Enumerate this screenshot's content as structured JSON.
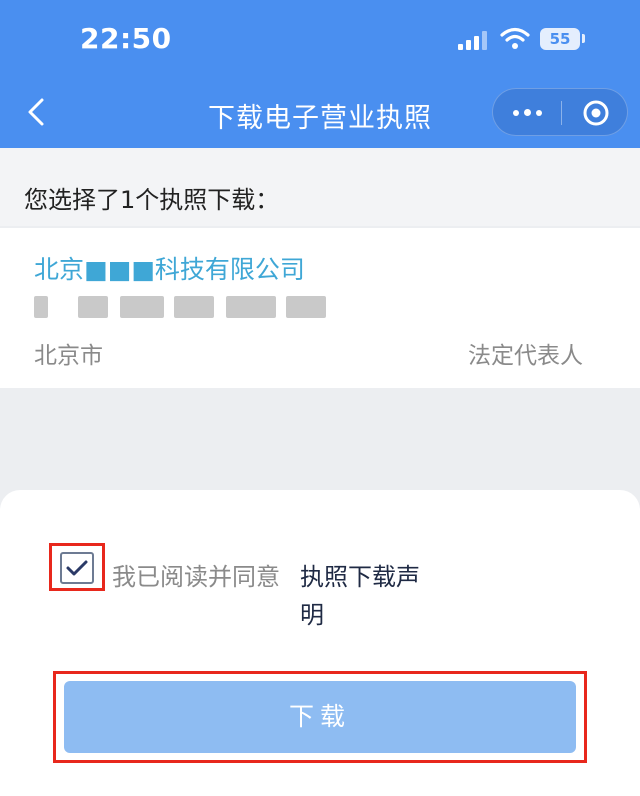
{
  "status_bar": {
    "time": "22:50",
    "battery": "55",
    "icons": [
      "signal-icon",
      "wifi-icon",
      "battery-icon"
    ]
  },
  "nav": {
    "title": "下载电子营业执照",
    "back_icon": "chevron-left-icon",
    "more_icon": "more-dots-icon",
    "close_icon": "target-close-icon"
  },
  "selection": {
    "header": "您选择了1个执照下载："
  },
  "license": {
    "company_name": "北京■■■科技有限公司",
    "city": "北京市",
    "role": "法定代表人"
  },
  "agreement": {
    "text": "我已阅读并同意",
    "link": "执照下载声明",
    "checked": true
  },
  "download_button": {
    "label": "下载"
  },
  "colors": {
    "header_blue": "#4a8ff0",
    "link_teal": "#3fa7d6",
    "button_blue": "#8ebcf2",
    "highlight_red": "#e8281c"
  }
}
